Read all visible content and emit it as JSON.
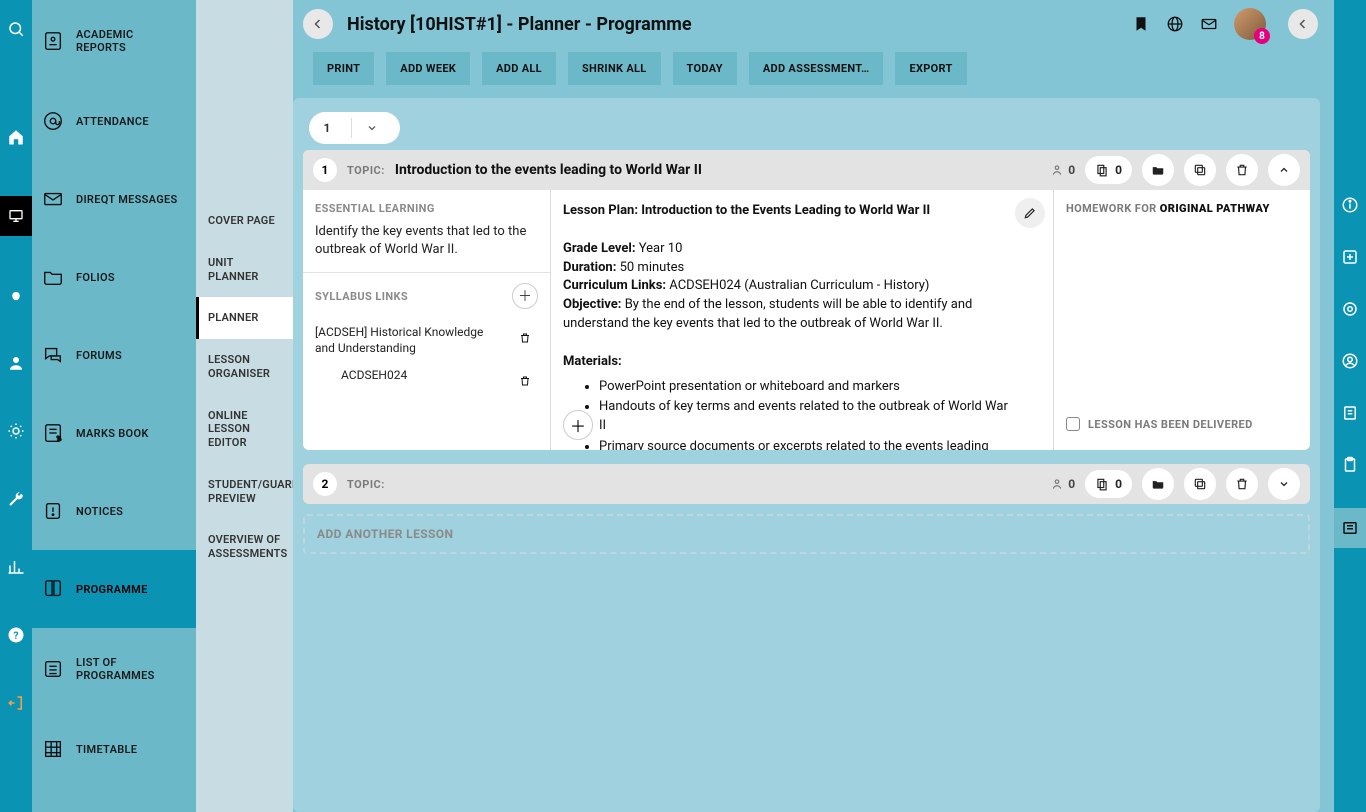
{
  "rail": {
    "icons": [
      "search",
      "home",
      "board",
      "hand",
      "user",
      "sun",
      "wrench",
      "chart",
      "help",
      "exit"
    ]
  },
  "nav": {
    "items": [
      {
        "label": "ACADEMIC REPORTS",
        "icon": "report"
      },
      {
        "label": "ATTENDANCE",
        "icon": "at"
      },
      {
        "label": "DIREQT MESSAGES",
        "icon": "mail"
      },
      {
        "label": "FOLIOS",
        "icon": "folder"
      },
      {
        "label": "FORUMS",
        "icon": "chat"
      },
      {
        "label": "MARKS BOOK",
        "icon": "marks"
      },
      {
        "label": "NOTICES",
        "icon": "notice"
      },
      {
        "label": "PROGRAMME",
        "icon": "book",
        "active": true
      },
      {
        "label": "LIST OF PROGRAMMES",
        "icon": "list"
      },
      {
        "label": "TIMETABLE",
        "icon": "grid"
      }
    ]
  },
  "sub": {
    "items": [
      {
        "label": "COVER PAGE"
      },
      {
        "label": "UNIT PLANNER"
      },
      {
        "label": "PLANNER",
        "active": true
      },
      {
        "label": "LESSON ORGANISER"
      },
      {
        "label": "ONLINE LESSON EDITOR"
      },
      {
        "label": "STUDENT/GUARDIAN PREVIEW"
      },
      {
        "label": "OVERVIEW OF ASSESSMENTS"
      }
    ]
  },
  "header": {
    "title": "History [10HIST#1] - Planner - Programme",
    "badge": "8"
  },
  "cmdbar": [
    "PRINT",
    "ADD WEEK",
    "ADD ALL",
    "SHRINK ALL",
    "TODAY",
    "ADD ASSESSMENT…",
    "EXPORT"
  ],
  "week": {
    "number": "1"
  },
  "lesson1": {
    "num": "1",
    "topic_label": "TOPIC:",
    "topic_title": "Introduction to the events leading to World War II",
    "people_count": "0",
    "files_count": "0",
    "essential_label": "ESSENTIAL LEARNING",
    "essential_text": "Identify the key events that led to the outbreak of World War II.",
    "syllabus_label": "SYLLABUS LINKS",
    "syllabus_item": "[ACDSEH] Historical Knowledge and Understanding",
    "syllabus_code": "ACDSEH024",
    "plan_title": "Lesson Plan: Introduction to the Events Leading to World War II",
    "grade_label": "Grade Level:",
    "grade_value": " Year 10",
    "duration_label": "Duration:",
    "duration_value": " 50 minutes",
    "curriculum_label": "Curriculum Links:",
    "curriculum_value": " ACDSEH024 (Australian Curriculum - History)",
    "objective_label": "Objective:",
    "objective_value": " By the end of the lesson, students will be able to identify and understand the key events that led to the outbreak of World War II.",
    "materials_label": "Materials:",
    "materials": [
      "PowerPoint presentation or whiteboard and markers",
      "Handouts of key terms and events related to the outbreak of World War II",
      "Primary source documents or excerpts related to the events leading"
    ],
    "homework_label": "HOMEWORK FOR ",
    "homework_pathway": "ORIGINAL PATHWAY",
    "delivered_label": "LESSON HAS BEEN DELIVERED"
  },
  "lesson2": {
    "num": "2",
    "topic_label": "TOPIC:",
    "people_count": "0",
    "files_count": "0"
  },
  "add_lesson": "ADD ANOTHER LESSON"
}
